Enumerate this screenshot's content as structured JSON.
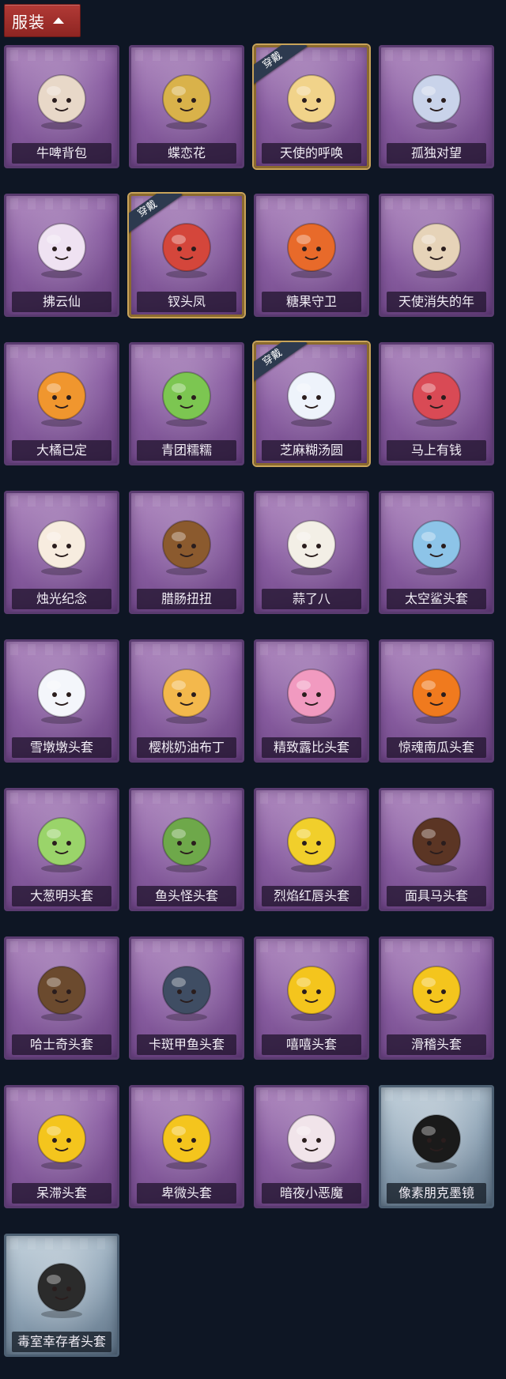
{
  "header": {
    "label": "服装"
  },
  "equipped_badge": "穿戴",
  "items": [
    {
      "label": "牛啤背包",
      "icon": "cow-beer-backpack-icon",
      "color": "#e8d8c8",
      "tier": "purple",
      "equipped": false
    },
    {
      "label": "蝶恋花",
      "icon": "butterfly-bell-charm-icon",
      "color": "#d9b24a",
      "tier": "purple",
      "equipped": false
    },
    {
      "label": "天使的呼唤",
      "icon": "angel-charm-icon",
      "color": "#f1d38a",
      "tier": "purple",
      "equipped": true
    },
    {
      "label": "孤独对望",
      "icon": "lonely-gaze-charm-icon",
      "color": "#c9d3ea",
      "tier": "purple",
      "equipped": false
    },
    {
      "label": "拂云仙",
      "icon": "cloud-fairy-charm-icon",
      "color": "#efe2f2",
      "tier": "purple",
      "equipped": false
    },
    {
      "label": "钗头凤",
      "icon": "phoenix-hairpin-charm-icon",
      "color": "#d4463b",
      "tier": "purple",
      "equipped": true
    },
    {
      "label": "糖果守卫",
      "icon": "pumpkin-candy-guard-icon",
      "color": "#e86a2a",
      "tier": "purple",
      "equipped": false
    },
    {
      "label": "天使消失的年",
      "icon": "angel-girl-charm-icon",
      "color": "#e6d3b8",
      "tier": "purple",
      "equipped": false
    },
    {
      "label": "大橘已定",
      "icon": "orange-slice-icon",
      "color": "#f0962e",
      "tier": "purple",
      "equipped": false
    },
    {
      "label": "青团糯糯",
      "icon": "green-rice-ball-icon",
      "color": "#7cc651",
      "tier": "purple",
      "equipped": false
    },
    {
      "label": "芝麻糊汤圆",
      "icon": "sesame-dumpling-icon",
      "color": "#eef3fb",
      "tier": "purple",
      "equipped": true
    },
    {
      "label": "马上有钱",
      "icon": "red-horse-icon",
      "color": "#d94a55",
      "tier": "purple",
      "equipped": false
    },
    {
      "label": "烛光纪念",
      "icon": "candle-icon",
      "color": "#f7ecdf",
      "tier": "purple",
      "equipped": false
    },
    {
      "label": "腊肠扭扭",
      "icon": "dachshund-icon",
      "color": "#8b5a2e",
      "tier": "purple",
      "equipped": false
    },
    {
      "label": "蒜了八",
      "icon": "garlic-icon",
      "color": "#f3efe6",
      "tier": "purple",
      "equipped": false
    },
    {
      "label": "太空鲨头套",
      "icon": "shark-head-icon",
      "color": "#8dc4e8",
      "tier": "purple",
      "equipped": false
    },
    {
      "label": "雪墩墩头套",
      "icon": "snowman-head-icon",
      "color": "#f4f6fb",
      "tier": "purple",
      "equipped": false
    },
    {
      "label": "樱桃奶油布丁",
      "icon": "cherry-pudding-icon",
      "color": "#f3b84c",
      "tier": "purple",
      "equipped": false
    },
    {
      "label": "精致露比头套",
      "icon": "pink-beaver-head-icon",
      "color": "#f19ac0",
      "tier": "purple",
      "equipped": false
    },
    {
      "label": "惊魂南瓜头套",
      "icon": "jack-o-lantern-icon",
      "color": "#f07a1e",
      "tier": "purple",
      "equipped": false
    },
    {
      "label": "大葱明头套",
      "icon": "scallion-head-icon",
      "color": "#9ad46a",
      "tier": "purple",
      "equipped": false
    },
    {
      "label": "鱼头怪头套",
      "icon": "fish-head-mask-icon",
      "color": "#6ea84a",
      "tier": "purple",
      "equipped": false
    },
    {
      "label": "烈焰红唇头套",
      "icon": "yellow-mouse-head-icon",
      "color": "#f1cf2b",
      "tier": "purple",
      "equipped": false
    },
    {
      "label": "面具马头套",
      "icon": "horse-mask-icon",
      "color": "#5b3524",
      "tier": "purple",
      "equipped": false
    },
    {
      "label": "哈士奇头套",
      "icon": "husky-head-icon",
      "color": "#6b4a2e",
      "tier": "purple",
      "equipped": false
    },
    {
      "label": "卡斑甲鱼头套",
      "icon": "stingray-head-icon",
      "color": "#3f4d63",
      "tier": "purple",
      "equipped": false
    },
    {
      "label": "嘻嘻头套",
      "icon": "grinning-emoji-icon",
      "color": "#f4c51d",
      "tier": "purple",
      "equipped": false
    },
    {
      "label": "滑稽头套",
      "icon": "smirk-emoji-icon",
      "color": "#f4c51d",
      "tier": "purple",
      "equipped": false
    },
    {
      "label": "呆滞头套",
      "icon": "dazed-emoji-icon",
      "color": "#f4c51d",
      "tier": "purple",
      "equipped": false
    },
    {
      "label": "卑微头套",
      "icon": "humble-emoji-icon",
      "color": "#f4c51d",
      "tier": "purple",
      "equipped": false
    },
    {
      "label": "暗夜小恶魔",
      "icon": "little-devil-icon",
      "color": "#f1e4ea",
      "tier": "purple",
      "equipped": false
    },
    {
      "label": "像素朋克墨镜",
      "icon": "pixel-sunglasses-icon",
      "color": "#1a1a1a",
      "tier": "silver",
      "equipped": false
    },
    {
      "label": "毒室幸存者头套",
      "icon": "gas-mask-helmet-icon",
      "color": "#2b2b2b",
      "tier": "silver",
      "equipped": false
    }
  ]
}
